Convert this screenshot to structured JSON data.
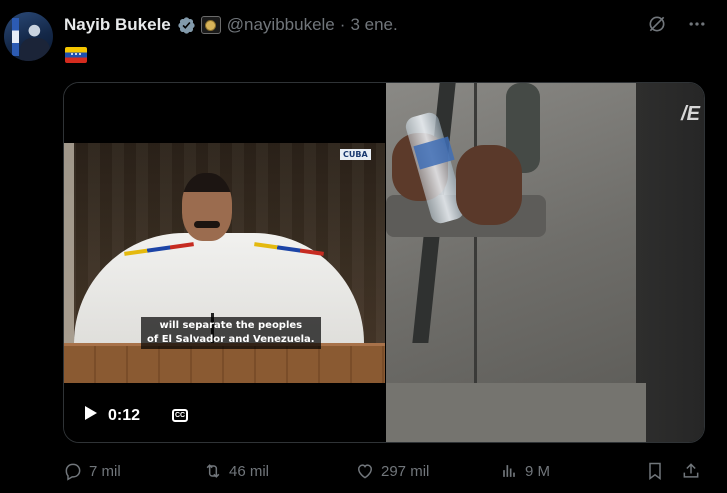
{
  "author": {
    "name": "Nayib Bukele",
    "handle": "@nayibbukele",
    "separator": "·",
    "time": "3 ene."
  },
  "tweet": {
    "emoji_icon": "venezuela-flag-icon"
  },
  "media": {
    "video": {
      "badge": "CUBA",
      "subtitle_line1": "will separate the peoples",
      "subtitle_line2": "of El Salvador and Venezuela.",
      "timestamp": "0:12",
      "cc_label": "CC"
    },
    "photo": {
      "logo_text": "/E"
    }
  },
  "actions": {
    "replies": "7 mil",
    "reposts": "46 mil",
    "likes": "297 mil",
    "views": "9 M"
  },
  "colors": {
    "background": "#000000",
    "text_primary": "#e7e9ea",
    "text_secondary": "#71767b",
    "verified": "#829aab",
    "border": "#2f3336"
  }
}
